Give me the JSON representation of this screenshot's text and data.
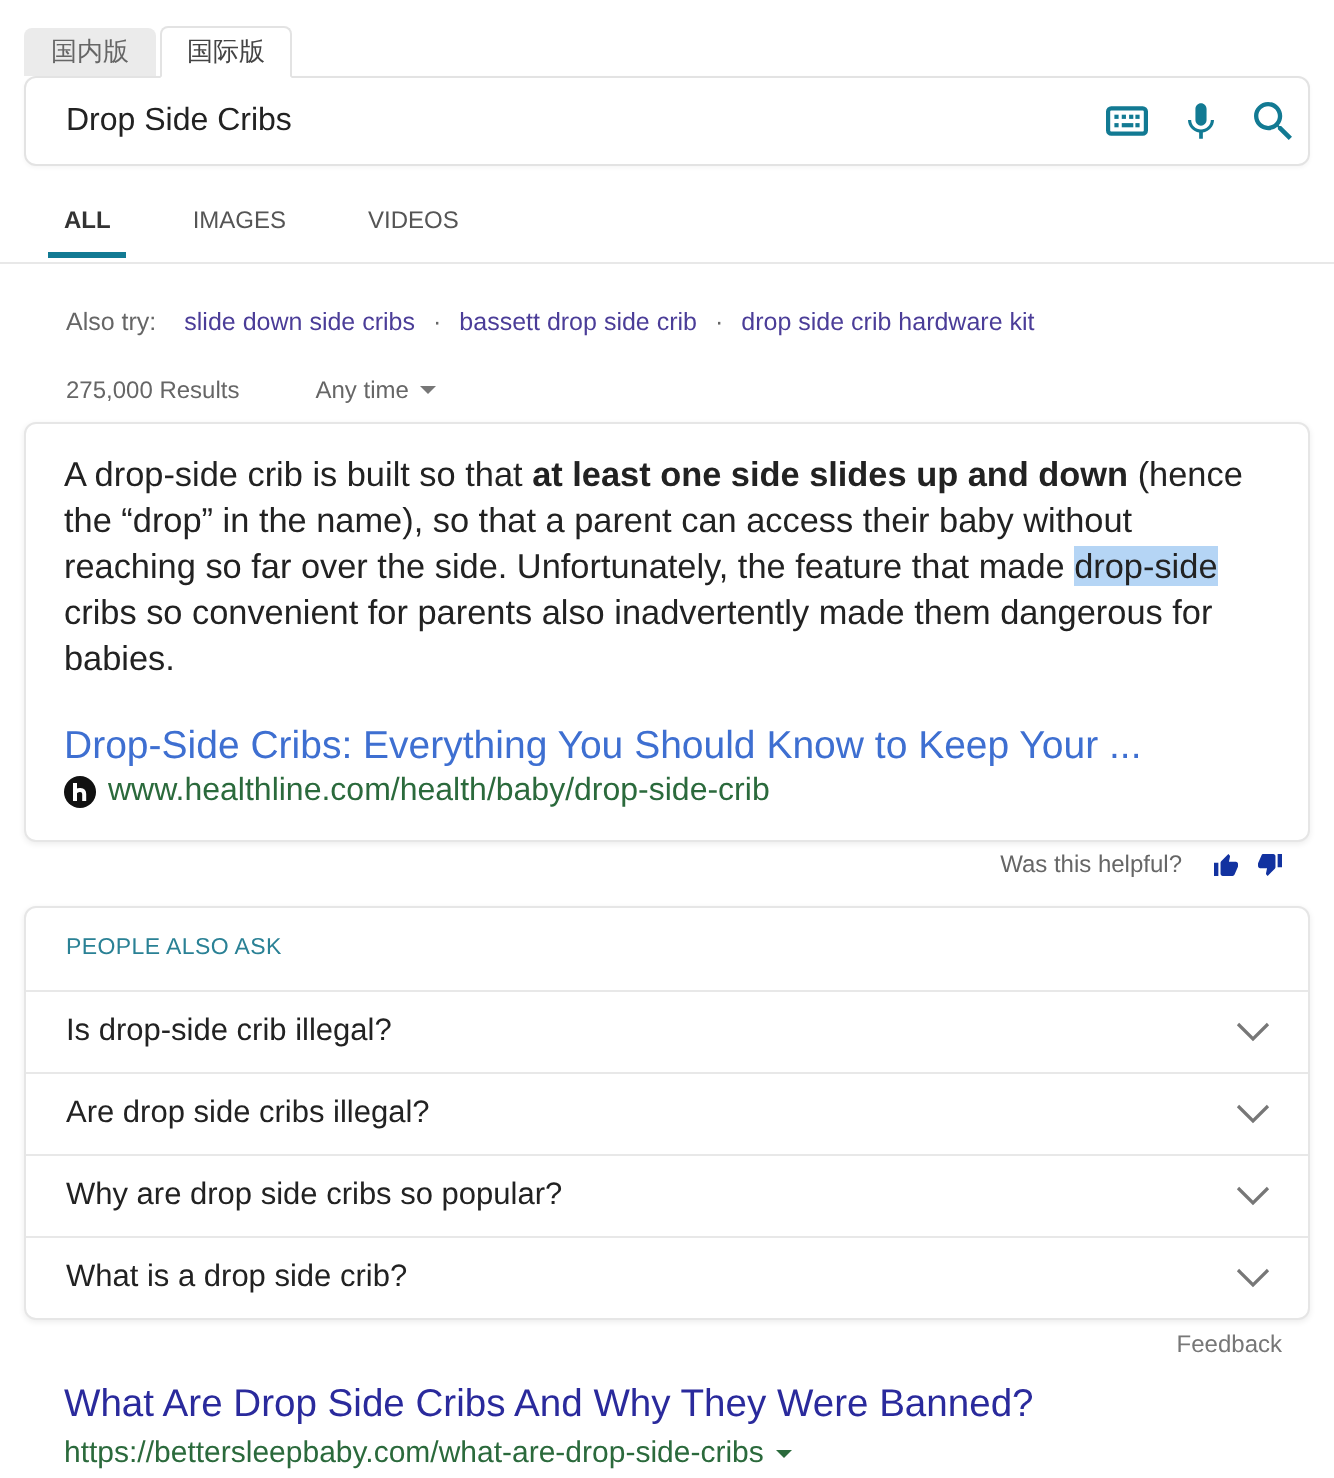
{
  "version_tabs": [
    {
      "label": "国内版",
      "selected": false
    },
    {
      "label": "国际版",
      "selected": true
    }
  ],
  "search": {
    "value": "Drop Side Cribs"
  },
  "nav_tabs": [
    {
      "label": "ALL",
      "selected": true
    },
    {
      "label": "IMAGES",
      "selected": false
    },
    {
      "label": "VIDEOS",
      "selected": false
    }
  ],
  "also_try": {
    "label": "Also try:",
    "items": [
      {
        "kind": "link",
        "text": "slide down side cribs"
      },
      {
        "kind": "separator",
        "text": "·"
      },
      {
        "kind": "link",
        "text": "bassett drop side crib"
      },
      {
        "kind": "separator",
        "text": "·"
      },
      {
        "kind": "link",
        "text": "drop side crib hardware kit"
      }
    ]
  },
  "results_info": {
    "count": "275,000 Results",
    "time_filter": "Any time"
  },
  "answer_card": {
    "segments": [
      {
        "kind": "plain",
        "text": "A drop-side crib is built so that "
      },
      {
        "kind": "bold",
        "text": "at least one side slides up and down"
      },
      {
        "kind": "plain",
        "text": " (hence the “drop” in the name), so that a parent can access their baby without reaching so far over the side. Unfortunately, the feature that made "
      },
      {
        "kind": "highlighted",
        "text": "drop-side"
      },
      {
        "kind": "plain",
        "text": " cribs so convenient for parents also inadvertently made them dangerous for babies."
      }
    ],
    "title": "Drop-Side Cribs: Everything You Should Know to Keep Your ...",
    "url": "www.healthline.com/health/baby/drop-side-crib"
  },
  "helpful": {
    "label": "Was this helpful?"
  },
  "people_also_ask": {
    "heading": "PEOPLE ALSO ASK",
    "questions": [
      {
        "text": "Is drop-side crib illegal?",
        "expanded": false
      },
      {
        "text": "Are drop side cribs illegal?",
        "expanded": false
      },
      {
        "text": "Why are drop side cribs so popular?",
        "expanded": false
      },
      {
        "text": "What is a drop side crib?",
        "expanded": false
      }
    ]
  },
  "feedback": "Feedback",
  "results": [
    {
      "title": "What Are Drop Side Cribs And Why They Were Banned?",
      "url": "https://bettersleepbaby.com/what-are-drop-side-cribs"
    }
  ]
}
